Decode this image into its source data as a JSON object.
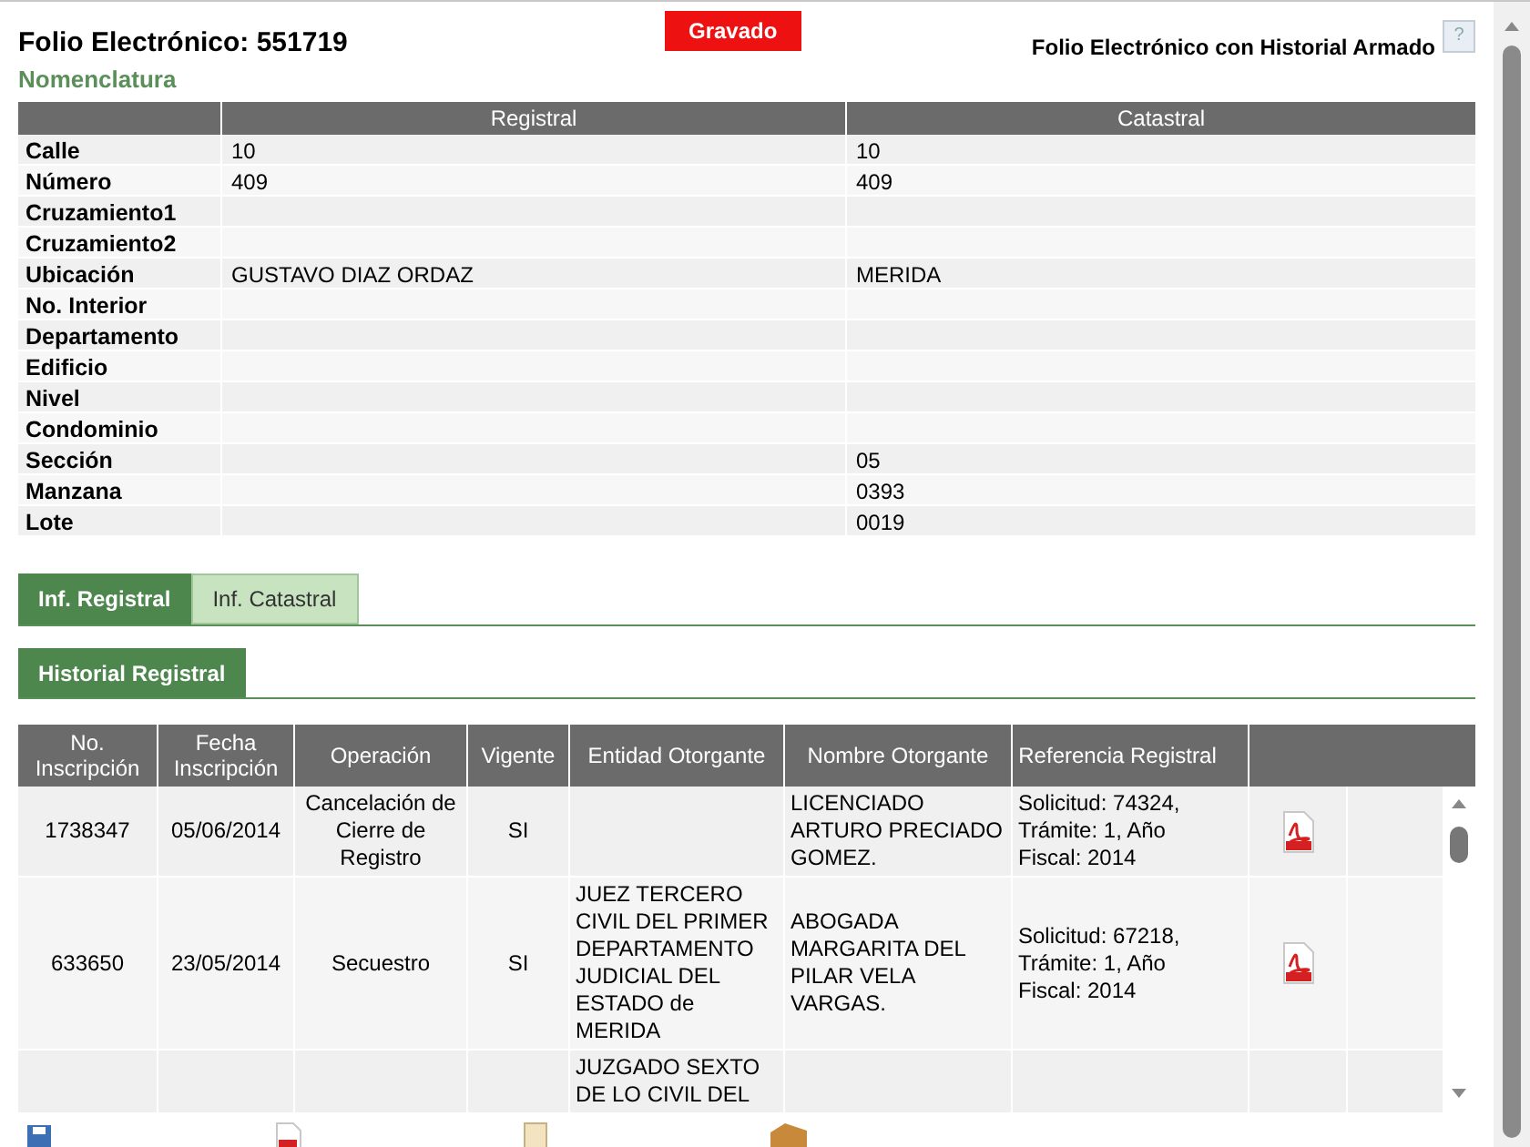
{
  "header": {
    "title": "Folio Electrónico: 551719",
    "badge": "Gravado",
    "subtitle": "Folio Electrónico con Historial Armado",
    "help": "?"
  },
  "nomenclatura": {
    "title": "Nomenclatura",
    "columns": [
      "Registral",
      "Catastral"
    ],
    "rows": [
      {
        "label": "Calle",
        "registral": "10",
        "catastral": "10"
      },
      {
        "label": "Número",
        "registral": "409",
        "catastral": "409"
      },
      {
        "label": "Cruzamiento1"
      },
      {
        "label": "Cruzamiento2"
      },
      {
        "label": "Ubicación",
        "registral": "GUSTAVO DIAZ ORDAZ",
        "catastral": "MERIDA"
      },
      {
        "label": "No. Interior"
      },
      {
        "label": "Departamento"
      },
      {
        "label": "Edificio"
      },
      {
        "label": "Nivel"
      },
      {
        "label": "Condominio"
      },
      {
        "label": "Sección",
        "catastral": "05"
      },
      {
        "label": "Manzana",
        "catastral": "0393"
      },
      {
        "label": "Lote",
        "catastral": "0019"
      }
    ]
  },
  "tabs": [
    {
      "label": "Inf. Registral",
      "selected": true
    },
    {
      "label": "Inf. Catastral",
      "selected": false
    }
  ],
  "subtabs": [
    {
      "label": "Historial Registral",
      "selected": true
    }
  ],
  "historial": {
    "columns": [
      "No. Inscripción",
      "Fecha Inscripción",
      "Operación",
      "Vigente",
      "Entidad Otorgante",
      "Nombre Otorgante",
      "Referencia Registral"
    ],
    "rows": [
      {
        "numero": "1738347",
        "fecha": "05/06/2014",
        "operacion": "Cancelación de Cierre de Registro",
        "vigente": "SI",
        "nombre": "LICENCIADO ARTURO PRECIADO GOMEZ.",
        "referencia": "Solicitud: 74324, Trámite: 1, Año Fiscal: 2014",
        "pdf": true
      },
      {
        "numero": "633650",
        "fecha": "23/05/2014",
        "operacion": "Secuestro",
        "vigente": "SI",
        "entidad": "JUEZ TERCERO CIVIL DEL PRIMER DEPARTAMENTO JUDICIAL DEL ESTADO de MERIDA",
        "nombre": "ABOGADA MARGARITA DEL PILAR VELA VARGAS.",
        "referencia": "Solicitud: 67218, Trámite: 1, Año Fiscal: 2014",
        "pdf": true
      },
      {
        "entidad": "JUZGADO SEXTO DE LO CIVIL DEL"
      }
    ]
  }
}
